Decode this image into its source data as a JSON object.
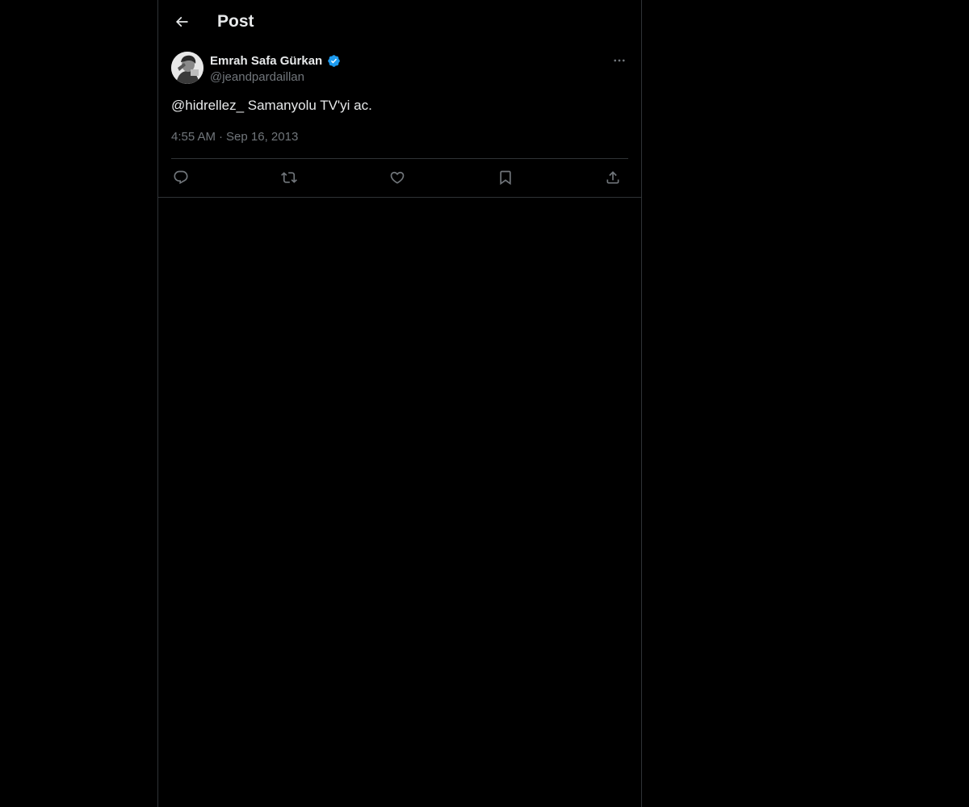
{
  "header": {
    "title": "Post",
    "back_icon": "arrow-left-icon"
  },
  "post": {
    "author": {
      "name": "Emrah Safa Gürkan",
      "handle": "@jeandpardaillan",
      "verified": true,
      "verified_color": "#1d9bf0"
    },
    "text": "@hidrellez_ Samanyolu TV'yi ac.",
    "time": "4:55 AM",
    "separator": "·",
    "date": "Sep 16, 2013",
    "more_icon": "more-horizontal-icon"
  },
  "actions": [
    {
      "name": "reply",
      "icon": "reply-icon"
    },
    {
      "name": "repost",
      "icon": "repost-icon"
    },
    {
      "name": "like",
      "icon": "heart-icon"
    },
    {
      "name": "bookmark",
      "icon": "bookmark-icon"
    },
    {
      "name": "share",
      "icon": "share-icon"
    }
  ],
  "colors": {
    "background": "#000000",
    "text_primary": "#e7e9ea",
    "text_secondary": "#71767b",
    "border": "#2f3336",
    "accent": "#1d9bf0"
  }
}
